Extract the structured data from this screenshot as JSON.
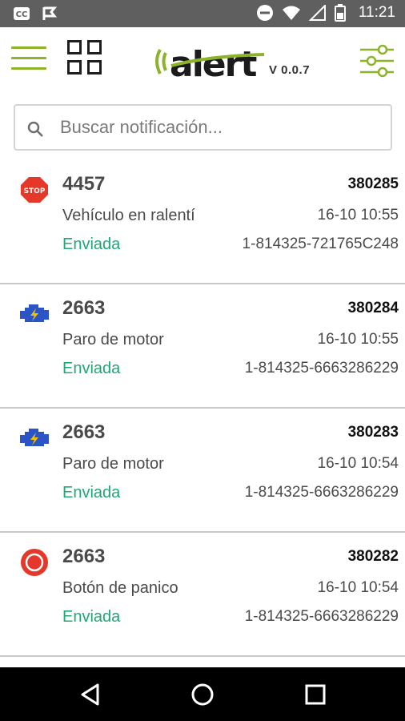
{
  "status_bar": {
    "time": "11:21",
    "left_icons": [
      "cc-icon",
      "flag-icon"
    ],
    "right_icons": [
      "do-not-disturb-icon",
      "wifi-icon",
      "signal-icon",
      "battery-icon"
    ]
  },
  "app_bar": {
    "logo_text": "alert",
    "version": "V 0.0.7",
    "accent_color": "#8db32b"
  },
  "search": {
    "placeholder": "Buscar notificación...",
    "value": ""
  },
  "notifications": [
    {
      "icon": "stop-sign-icon",
      "code": "4457",
      "description": "Vehículo en ralentí",
      "status": "Enviada",
      "id": "380285",
      "date": "16-10 10:55",
      "reference": "1-814325-721765C248"
    },
    {
      "icon": "engine-icon",
      "code": "2663",
      "description": "Paro de motor",
      "status": "Enviada",
      "id": "380284",
      "date": "16-10 10:55",
      "reference": "1-814325-6663286229"
    },
    {
      "icon": "engine-icon",
      "code": "2663",
      "description": "Paro de motor",
      "status": "Enviada",
      "id": "380283",
      "date": "16-10 10:54",
      "reference": "1-814325-6663286229"
    },
    {
      "icon": "panic-button-icon",
      "code": "2663",
      "description": "Botón de panico",
      "status": "Enviada",
      "id": "380282",
      "date": "16-10 10:54",
      "reference": "1-814325-6663286229"
    }
  ],
  "colors": {
    "status_sent": "#1fa874",
    "stop_red": "#e5382a",
    "engine_blue": "#2b54c6"
  },
  "nav_bar": {
    "buttons": [
      "back-icon",
      "home-icon",
      "recents-icon"
    ]
  }
}
